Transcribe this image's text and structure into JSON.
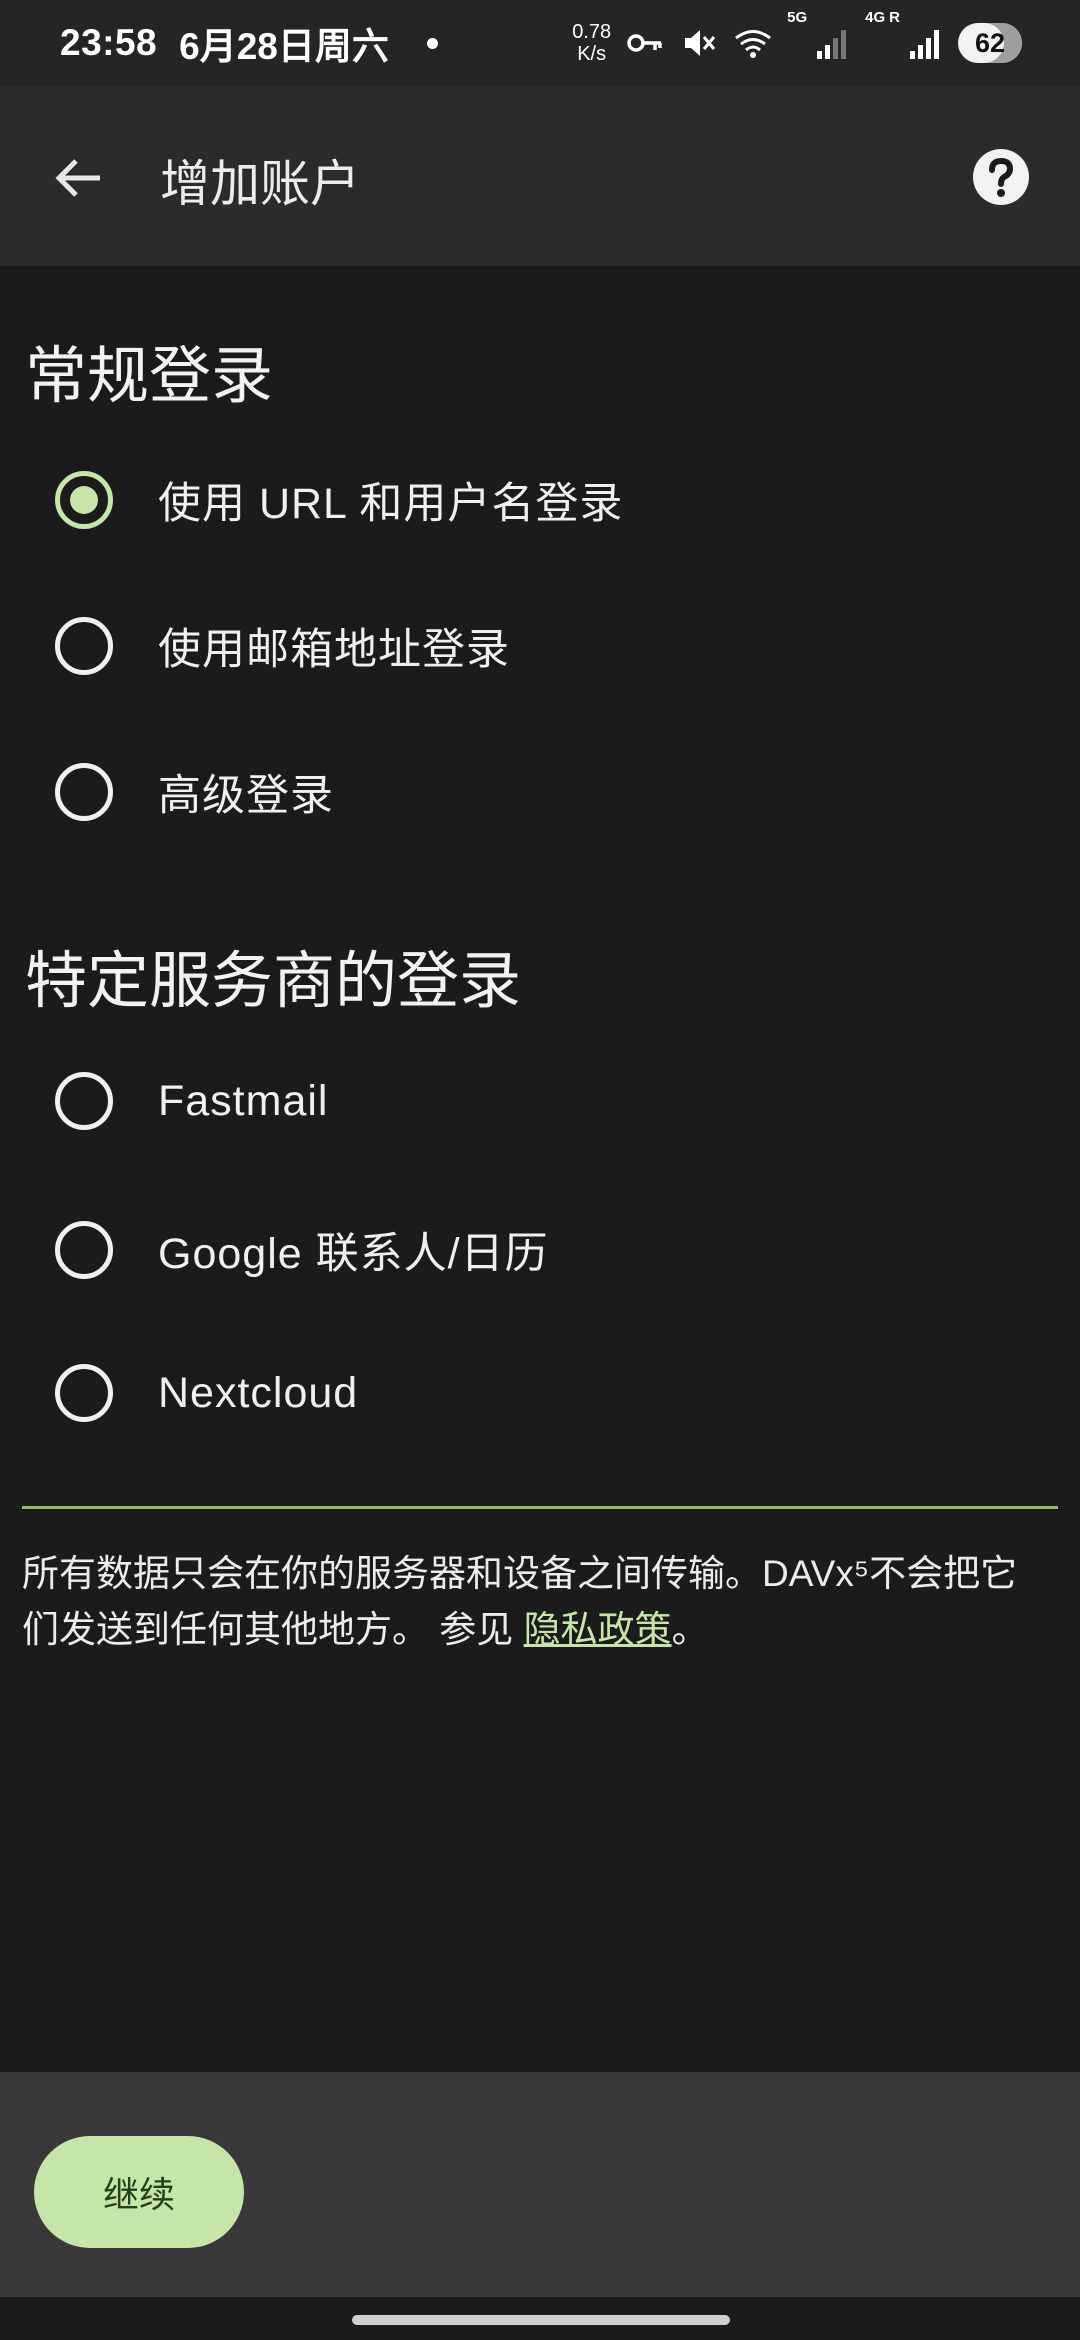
{
  "status_bar": {
    "time": "23:58",
    "date": "6月28日周六",
    "net_speed_value": "0.78",
    "net_speed_unit": "K/s",
    "sim1_label": "5G",
    "sim2_label": "4G",
    "roaming_label": "R",
    "battery": "62",
    "icons": [
      "notification-dot-icon",
      "vpn-key-icon",
      "mute-icon",
      "wifi-icon",
      "signal-icon",
      "signal-icon",
      "battery-icon"
    ]
  },
  "app_bar": {
    "title": "增加账户",
    "icons": [
      "back-arrow-icon",
      "help-icon"
    ]
  },
  "general_login": {
    "title": "常规登录",
    "options": [
      {
        "label": "使用 URL 和用户名登录",
        "checked": true
      },
      {
        "label": "使用邮箱地址登录",
        "checked": false
      },
      {
        "label": "高级登录",
        "checked": false
      }
    ]
  },
  "provider_login": {
    "title": "特定服务商的登录",
    "options": [
      {
        "label": "Fastmail",
        "checked": false
      },
      {
        "label": "Google 联系人/日历",
        "checked": false
      },
      {
        "label": "Nextcloud",
        "checked": false
      }
    ]
  },
  "notice": {
    "text": "所有数据只会在你的服务器和设备之间传输。DAVx⁵不会把它们发送到任何其他地方。 参见 ",
    "link": "隐私政策",
    "suffix": "。"
  },
  "footer": {
    "continue_label": "继续"
  },
  "colors": {
    "accent": "#c6e5a9",
    "background": "#1b1b1b",
    "app_bar": "#2b2b2b",
    "bottom_bar": "#393939",
    "divider": "#8fb86a"
  }
}
